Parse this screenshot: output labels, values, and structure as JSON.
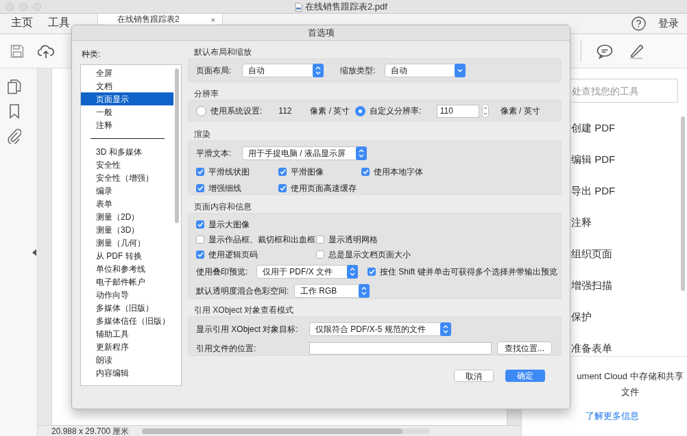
{
  "window": {
    "title": "在线销售跟踪表2.pdf"
  },
  "top_tabs": [
    {
      "label": "主页",
      "selected": false
    },
    {
      "label": "工具",
      "selected": false
    }
  ],
  "doc_tab": {
    "label": "在线销售跟踪表2",
    "close": "×",
    "selected": true
  },
  "account": {
    "login": "登录"
  },
  "tools_panel": {
    "search_placeholder": "处查找您的工具",
    "tools": [
      "创建 PDF",
      "编辑 PDF",
      "导出 PDF",
      "注释",
      "组织页面",
      "增强扫描",
      "保护",
      "准备表单"
    ],
    "cloud_text": "ument Cloud 中存储和共享文件",
    "learn_more": "了解更多信息"
  },
  "status_bar": {
    "page_size": "20.988 x 29.700 厘米"
  },
  "dialog": {
    "title": "首选项",
    "categories_label": "种类:",
    "categories": [
      {
        "label": "全屏",
        "selected": false
      },
      {
        "label": "文档",
        "selected": false
      },
      {
        "label": "页面显示",
        "selected": true
      },
      {
        "label": "一般",
        "selected": false
      },
      {
        "label": "注释",
        "selected": false
      }
    ],
    "more_categories": [
      {
        "label": "3D 和多媒体",
        "selected": false
      },
      {
        "label": "安全性",
        "selected": false
      },
      {
        "label": "安全性（增强）",
        "selected": false
      },
      {
        "label": "编录",
        "selected": false
      },
      {
        "label": "表单",
        "selected": false
      },
      {
        "label": "测量（2D）",
        "selected": false
      },
      {
        "label": "测量（3D）",
        "selected": false
      },
      {
        "label": "测量（几何）",
        "selected": false
      },
      {
        "label": "从 PDF 转换",
        "selected": false
      },
      {
        "label": "单位和参考线",
        "selected": false
      },
      {
        "label": "电子邮件帐户",
        "selected": false
      },
      {
        "label": "动作向导",
        "selected": false
      },
      {
        "label": "多媒体（旧版）",
        "selected": false
      },
      {
        "label": "多媒体信任（旧版）",
        "selected": false
      },
      {
        "label": "辅助工具",
        "selected": false
      },
      {
        "label": "更新程序",
        "selected": false
      },
      {
        "label": "朗读",
        "selected": false
      },
      {
        "label": "内容编辑",
        "selected": false
      }
    ],
    "layout": {
      "heading": "默认布局和缩放",
      "page_layout": {
        "label": "页面布局:",
        "value": "自动",
        "kind": "popup"
      },
      "zoom_type": {
        "label": "缩放类型:",
        "value": "自动",
        "kind": "pulldown"
      }
    },
    "resolution": {
      "heading": "分辨率",
      "system": {
        "label": "使用系统设置:",
        "value": "112",
        "unit": "像素 / 英寸",
        "selected": false
      },
      "custom": {
        "label": "自定义分辨率:",
        "value": "110",
        "unit": "像素 / 英寸",
        "selected": true
      }
    },
    "rendering": {
      "heading": "渲染",
      "smooth_text": {
        "label": "平滑文本:",
        "value": "用于手提电脑 / 液晶显示屏",
        "kind": "popup"
      },
      "options": [
        {
          "label": "平滑线状图",
          "checked": true
        },
        {
          "label": "平滑图像",
          "checked": true
        },
        {
          "label": "使用本地字体",
          "checked": true
        },
        {
          "label": "增强细线",
          "checked": true
        },
        {
          "label": "使用页面高速缓存",
          "checked": true
        }
      ]
    },
    "page_content": {
      "heading": "页面内容和信息",
      "option_rows": [
        [
          {
            "label": "显示大图像",
            "checked": true
          }
        ],
        [
          {
            "label": "显示作品框、裁切框和出血框",
            "checked": false
          },
          {
            "label": "显示透明网格",
            "checked": false
          }
        ],
        [
          {
            "label": "使用逻辑页码",
            "checked": true
          },
          {
            "label": "总是显示文档页面大小",
            "checked": false
          }
        ]
      ],
      "overprint": {
        "label": "使用叠印预览:",
        "value": "仅用于 PDF/X 文件",
        "kind": "popup"
      },
      "shift_option": {
        "label": "按住 Shift 键并单击可获得多个选择并带输出预览",
        "checked": true
      },
      "blend_space": {
        "label": "默认透明度混合色彩空间:",
        "value": "工作 RGB",
        "kind": "popup"
      }
    },
    "xobject": {
      "heading": "引用 XObject 对象查看模式",
      "target": {
        "label": "显示引用 XObject 对象目标:",
        "value": "仅限符合 PDF/X-5 规范的文件",
        "kind": "popup"
      },
      "location_label": "引用文件的位置:",
      "find_button": "查找位置..."
    },
    "buttons": [
      {
        "label": "取消",
        "default": false
      },
      {
        "label": "确定",
        "default": true
      }
    ]
  }
}
